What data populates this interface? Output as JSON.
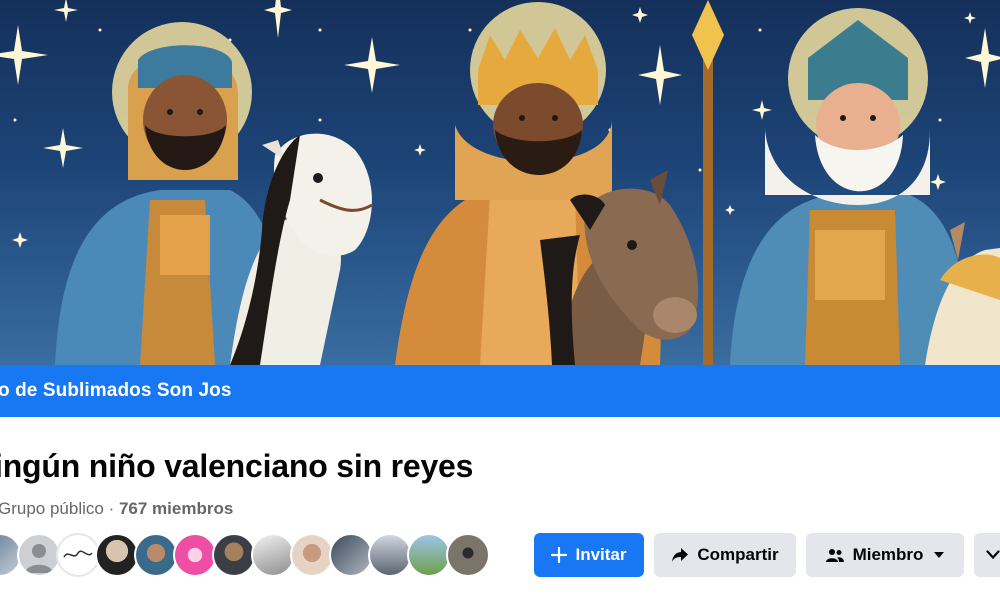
{
  "cover": {
    "description_icons": [
      "star-icon",
      "horse-icon",
      "king-icon"
    ]
  },
  "banner": {
    "text": "o de Sublimados Son Jos"
  },
  "group": {
    "title": "ingún niño valenciano sin reyes",
    "privacy": "Grupo público",
    "separator": " · ",
    "members": "767 miembros"
  },
  "actions": {
    "invite_label": "Invitar",
    "share_label": "Compartir",
    "member_label": "Miembro"
  },
  "colors": {
    "primary": "#1877f2",
    "secondary_bg": "#e4e6eb",
    "muted_text": "#65676b"
  }
}
